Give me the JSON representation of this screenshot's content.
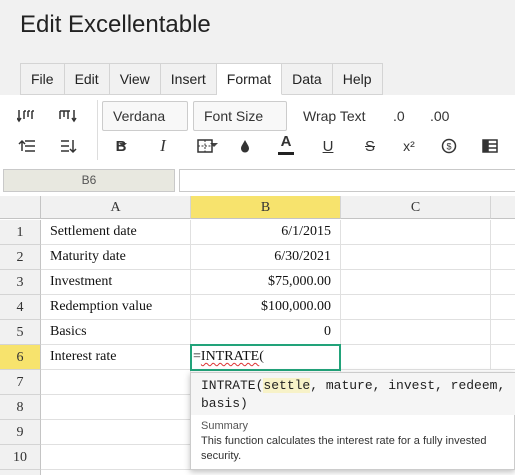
{
  "app": {
    "title": "Edit Excellentable"
  },
  "menu": {
    "tabs": [
      {
        "label": "File"
      },
      {
        "label": "Edit"
      },
      {
        "label": "View"
      },
      {
        "label": "Insert"
      },
      {
        "label": "Format"
      },
      {
        "label": "Data"
      },
      {
        "label": "Help"
      }
    ],
    "active": "Format"
  },
  "toolbar": {
    "font_family": "Verdana",
    "font_size": "Font Size",
    "wrap_text": "Wrap Text",
    "decrease_decimal": ".0",
    "increase_decimal": ".00",
    "bold": "B",
    "italic": "I",
    "text_color": "A",
    "underline": "U",
    "strikethrough": "S",
    "superscript": "x²",
    "currency": "$"
  },
  "formula_bar": {
    "cell_ref": "B6",
    "value": ""
  },
  "grid": {
    "columns": [
      "A",
      "B",
      "C"
    ],
    "rows": [
      {
        "num": "1",
        "a": "Settlement date",
        "b": "6/1/2015"
      },
      {
        "num": "2",
        "a": "Maturity date",
        "b": "6/30/2021"
      },
      {
        "num": "3",
        "a": "Investment",
        "b": "$75,000.00"
      },
      {
        "num": "4",
        "a": "Redemption value",
        "b": "$100,000.00"
      },
      {
        "num": "5",
        "a": "Basics",
        "b": "0"
      },
      {
        "num": "6",
        "a": "Interest rate",
        "b": ""
      },
      {
        "num": "7",
        "a": "",
        "b": ""
      },
      {
        "num": "8",
        "a": "",
        "b": ""
      },
      {
        "num": "9",
        "a": "",
        "b": ""
      },
      {
        "num": "10",
        "a": "",
        "b": ""
      }
    ],
    "selected_col": "B",
    "selected_row": "6",
    "editing_prefix": "=",
    "editing_func": "INTRATE",
    "editing_suffix": "("
  },
  "autocomplete": {
    "func": "INTRATE(",
    "param_active": "settle",
    "params_rest": ", mature, invest, redeem,",
    "params_line2": "basis)",
    "summary_label": "Summary",
    "summary_text": "This function calculates the interest rate for a fully invested security."
  },
  "colors": {
    "accent": "#22a37a",
    "selection": "#f7e36d"
  }
}
